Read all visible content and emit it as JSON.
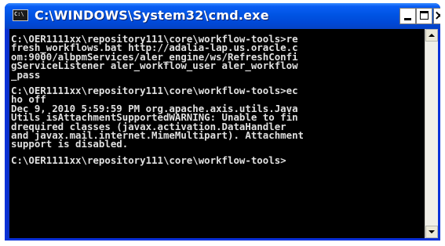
{
  "window": {
    "title": "C:\\WINDOWS\\System32\\cmd.exe",
    "icon_name": "console-app-icon",
    "icon_text": "C:\\",
    "buttons": [
      {
        "name": "minimize",
        "glyph": "_"
      },
      {
        "name": "maximize",
        "glyph": "□"
      },
      {
        "name": "close",
        "glyph": "×"
      }
    ]
  },
  "console": {
    "colors": {
      "background": "#000000",
      "text": "#e0e0e0"
    },
    "blocks": [
      {
        "lines": [
          "C:\\OER1111xx\\repository111\\core\\workflow-tools>re",
          "fresh_workflows.bat http://adalia-lap.us.oracle.c",
          "om:9000/albpmServices/aler_engine/ws/RefreshConfi",
          "gServiceListener aler_workflow_user aler_workflow",
          "_pass"
        ]
      },
      {
        "lines": [
          "C:\\OER1111xx\\repository111\\core\\workflow-tools>ec",
          "ho off",
          "Dec 9, 2010 5:59:59 PM org.apache.axis.utils.Java",
          "Utils isAttachmentSupportedWARNING: Unable to fin",
          "drequired classes (javax.activation.DataHandler",
          "and javax.mail.internet.MimeMultipart). Attachment",
          "support is disabled."
        ]
      },
      {
        "lines": [
          "C:\\OER1111xx\\repository111\\core\\workflow-tools>"
        ]
      }
    ]
  },
  "scrollbar": {
    "up_icon": "scroll-up-arrow-icon",
    "down_icon": "scroll-down-arrow-icon"
  }
}
